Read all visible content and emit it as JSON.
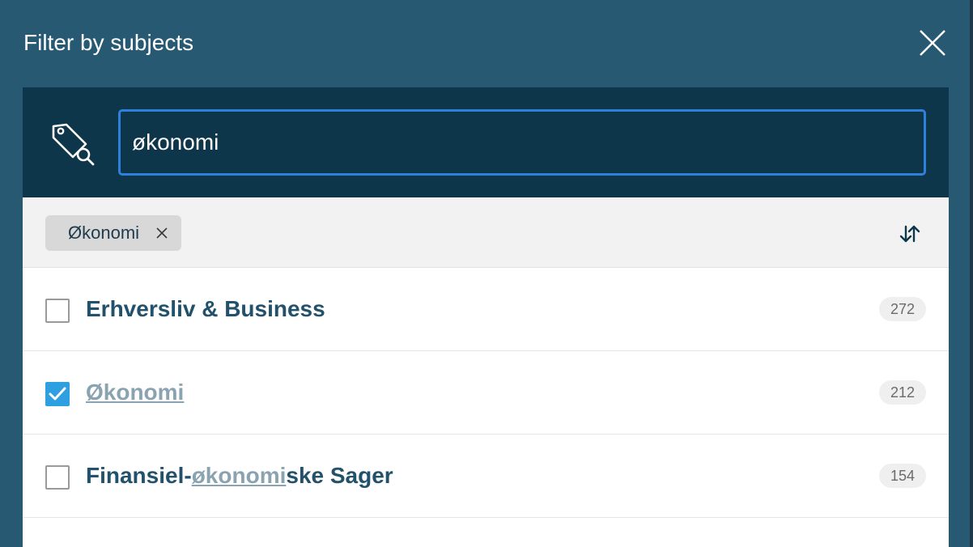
{
  "dialog": {
    "title": "Filter by subjects"
  },
  "search": {
    "value": "økonomi"
  },
  "chips": [
    {
      "label": "Økonomi"
    }
  ],
  "list": [
    {
      "label": "Erhversliv & Business",
      "count": "272",
      "checked": false
    },
    {
      "label": "Økonomi",
      "count": "212",
      "checked": true
    },
    {
      "label_pre": "Finansiel-",
      "label_hl": "økonomi",
      "label_post": "ske Sager",
      "count": "154",
      "checked": false
    }
  ],
  "colors": {
    "header_bg": "#275a72",
    "search_bg": "#0e364b",
    "input_border": "#2f7fdc",
    "checkbox_checked": "#2e9fe0",
    "label_text": "#22516b",
    "highlight_text": "#8aa3b1"
  },
  "icons": {
    "close": "close-icon",
    "tag_search": "tag-search-icon",
    "chip_remove": "close-icon",
    "sort": "sort-arrows-icon",
    "checkmark": "checkmark-icon"
  }
}
